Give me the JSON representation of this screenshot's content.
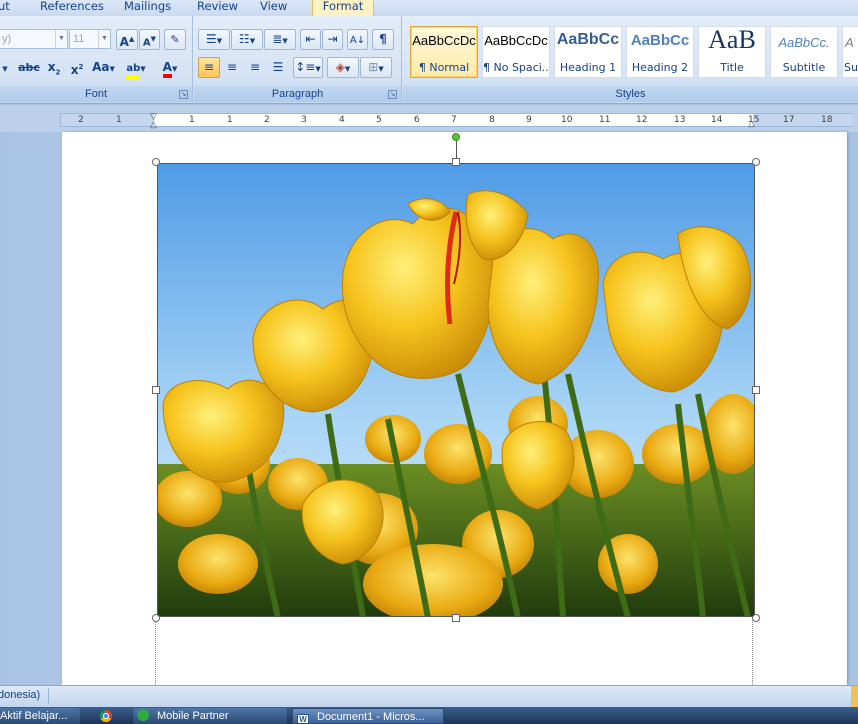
{
  "tabs": [
    "ut",
    "References",
    "Mailings",
    "Review",
    "View",
    "Format"
  ],
  "font_group": {
    "label": "Font",
    "font_name": "y)",
    "font_size": "11",
    "grow_label": "A",
    "shrink_label": "A",
    "strike_label": "abc",
    "subscript_label": "x",
    "superscript_label": "x",
    "change_case_label": "Aa",
    "highlight_label": "ab",
    "font_color_label": "A"
  },
  "paragraph_group": {
    "label": "Paragraph",
    "pilcrow": "¶"
  },
  "styles_group": {
    "label": "Styles",
    "items": [
      {
        "sample": "AaBbCcDc",
        "name": "¶ Normal"
      },
      {
        "sample": "AaBbCcDc",
        "name": "¶ No Spaci..."
      },
      {
        "sample": "AaBbCc",
        "name": "Heading 1"
      },
      {
        "sample": "AaBbCc",
        "name": "Heading 2"
      },
      {
        "sample": "AaB",
        "name": "Title"
      },
      {
        "sample": "AaBbCc.",
        "name": "Subtitle"
      },
      {
        "sample": "A",
        "name": "Sub"
      }
    ]
  },
  "ruler": {
    "labels": [
      "2",
      "1",
      "1",
      "1",
      "2",
      "3",
      "4",
      "5",
      "6",
      "7",
      "8",
      "9",
      "10",
      "11",
      "12",
      "13",
      "14",
      "15",
      "17",
      "18"
    ]
  },
  "status_bar": {
    "language": "donesia)"
  },
  "taskbar": {
    "items": [
      "Aktif Belajar...",
      "Mobile Partner",
      "Document1 - Micros..."
    ]
  },
  "colors": {
    "highlight": "#ffff00",
    "font_color": "#ff0000",
    "selection_handle": "#59c332"
  },
  "image": {
    "subject": "yellow tulips against blue sky"
  }
}
